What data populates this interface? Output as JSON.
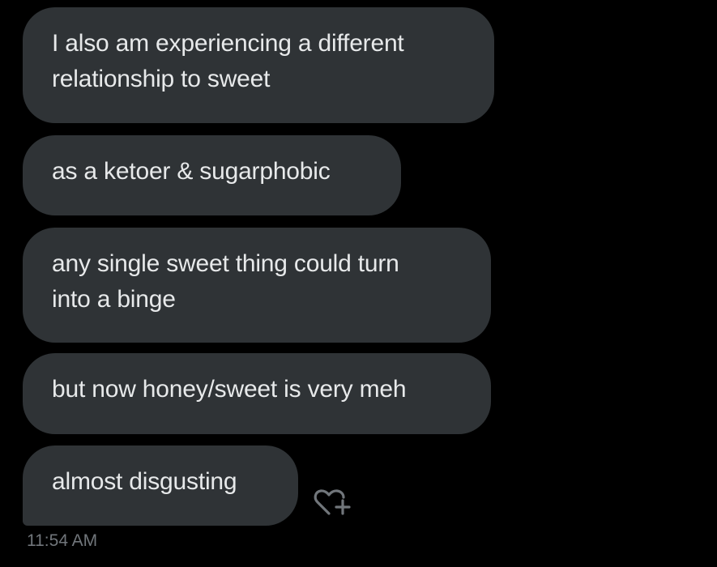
{
  "messages": [
    {
      "text": "I also am experiencing a different\nrelationship to sweet"
    },
    {
      "text": "as a ketoer & sugarphobic"
    },
    {
      "text": "any single sweet thing could turn\ninto a binge"
    },
    {
      "text": "but now honey/sweet is very meh"
    },
    {
      "text": "almost disgusting"
    }
  ],
  "timestamp": "11:54 AM",
  "reaction_icon": "heart-plus-icon",
  "colors": {
    "background": "#000000",
    "bubble": "#2f3336",
    "text": "#e7e9ea",
    "muted": "#71767b"
  }
}
